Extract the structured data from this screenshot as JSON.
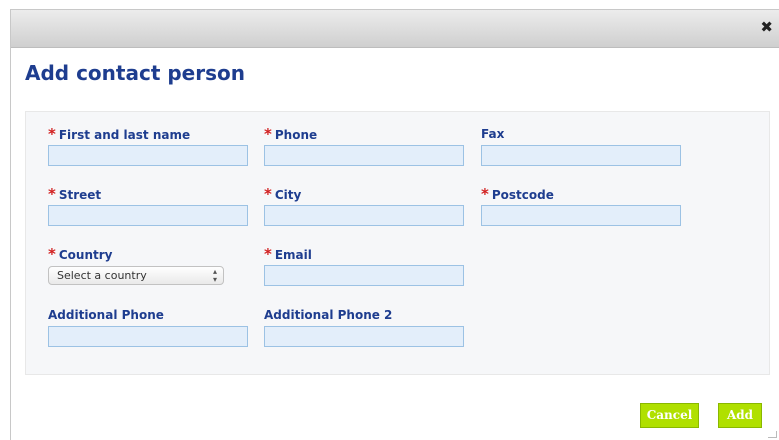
{
  "dialog": {
    "close_icon": "close-icon",
    "close_glyph": "✖",
    "title": "Add contact person"
  },
  "form": {
    "required_marker": "*",
    "full_name": {
      "label": "First and last name",
      "value": ""
    },
    "phone": {
      "label": "Phone",
      "value": ""
    },
    "fax": {
      "label": "Fax",
      "value": ""
    },
    "street": {
      "label": "Street",
      "value": ""
    },
    "city": {
      "label": "City",
      "value": ""
    },
    "postcode": {
      "label": "Postcode",
      "value": ""
    },
    "country": {
      "label": "Country",
      "selected": "Select a country"
    },
    "email": {
      "label": "Email",
      "value": ""
    },
    "additional_phone": {
      "label": "Additional Phone",
      "value": ""
    },
    "additional_phone_2": {
      "label": "Additional Phone 2",
      "value": ""
    }
  },
  "actions": {
    "cancel_label": "Cancel",
    "add_label": "Add",
    "accent_color": "#b0e000"
  },
  "colors": {
    "heading": "#1e3d8f",
    "required": "#d21f1f",
    "input_bg": "#e3eefa",
    "input_border": "#9cc2e4"
  }
}
